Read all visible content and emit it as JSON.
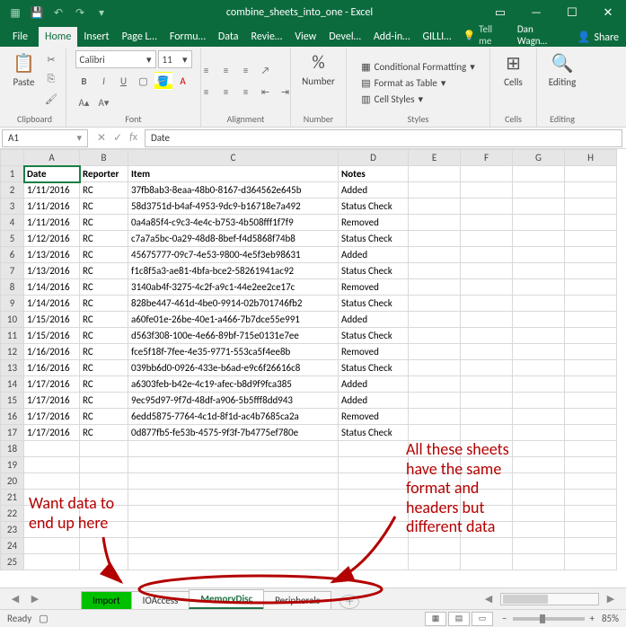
{
  "window": {
    "title": "combine_sheets_into_one - Excel"
  },
  "account": {
    "user": "Dan Wagn…",
    "share": "Share",
    "tellme": "Tell me"
  },
  "tabs": {
    "file": "File",
    "home": "Home",
    "insert": "Insert",
    "pagel": "Page L…",
    "formu": "Formu…",
    "data": "Data",
    "review": "Revie…",
    "view": "View",
    "devel": "Devel…",
    "addin": "Add-in…",
    "gilli": "GILLI…"
  },
  "ribbon": {
    "clipboard": "Clipboard",
    "paste": "Paste",
    "font": "Font",
    "fontname": "Calibri",
    "fontsize": "11",
    "alignment": "Alignment",
    "number": "Number",
    "numberbtn": "Number",
    "styles": "Styles",
    "cond": "Conditional Formatting",
    "table": "Format as Table",
    "cellstyles": "Cell Styles",
    "cells": "Cells",
    "cellsbtn": "Cells",
    "editing": "Editing",
    "editingbtn": "Editing"
  },
  "fx": {
    "namebox": "A1",
    "formula": "Date"
  },
  "columns": [
    "A",
    "B",
    "C",
    "D",
    "E",
    "F",
    "G",
    "H"
  ],
  "headers": {
    "A": "Date",
    "B": "Reporter",
    "C": "Item",
    "D": "Notes"
  },
  "rows": [
    {
      "n": 2,
      "A": "1/11/2016",
      "B": "RC",
      "C": "37fb8ab3-8eaa-48b0-8167-d364562e645b",
      "D": "Added"
    },
    {
      "n": 3,
      "A": "1/11/2016",
      "B": "RC",
      "C": "58d3751d-b4af-4953-9dc9-b16718e7a492",
      "D": "Status Check"
    },
    {
      "n": 4,
      "A": "1/11/2016",
      "B": "RC",
      "C": "0a4a85f4-c9c3-4e4c-b753-4b508fff1f7f9",
      "D": "Removed"
    },
    {
      "n": 5,
      "A": "1/12/2016",
      "B": "RC",
      "C": "c7a7a5bc-0a29-48d8-8bef-f4d5868f74b8",
      "D": "Status Check"
    },
    {
      "n": 6,
      "A": "1/13/2016",
      "B": "RC",
      "C": "45675777-09c7-4e53-9800-4e5f3eb98631",
      "D": "Added"
    },
    {
      "n": 7,
      "A": "1/13/2016",
      "B": "RC",
      "C": "f1c8f5a3-ae81-4bfa-bce2-58261941ac92",
      "D": "Status Check"
    },
    {
      "n": 8,
      "A": "1/14/2016",
      "B": "RC",
      "C": "3140ab4f-3275-4c2f-a9c1-44e2ee2ce17c",
      "D": "Removed"
    },
    {
      "n": 9,
      "A": "1/14/2016",
      "B": "RC",
      "C": "828be447-461d-4be0-9914-02b701746fb2",
      "D": "Status Check"
    },
    {
      "n": 10,
      "A": "1/15/2016",
      "B": "RC",
      "C": "a60fe01e-26be-40e1-a466-7b7dce55e991",
      "D": "Added"
    },
    {
      "n": 11,
      "A": "1/15/2016",
      "B": "RC",
      "C": "d563f308-100e-4e66-89bf-715e0131e7ee",
      "D": "Status Check"
    },
    {
      "n": 12,
      "A": "1/16/2016",
      "B": "RC",
      "C": "fce5f18f-7fee-4e35-9771-553ca5f4ee8b",
      "D": "Removed"
    },
    {
      "n": 13,
      "A": "1/16/2016",
      "B": "RC",
      "C": "039bb6d0-0926-433e-b6ad-e9c6f26616c8",
      "D": "Status Check"
    },
    {
      "n": 14,
      "A": "1/17/2016",
      "B": "RC",
      "C": "a6303feb-b42e-4c19-afec-b8d9f9fca385",
      "D": "Added"
    },
    {
      "n": 15,
      "A": "1/17/2016",
      "B": "RC",
      "C": "9ec95d97-9f7d-48df-a906-5b5fff8dd943",
      "D": "Added"
    },
    {
      "n": 16,
      "A": "1/17/2016",
      "B": "RC",
      "C": "6edd5875-7764-4c1d-8f1d-ac4b7685ca2a",
      "D": "Removed"
    },
    {
      "n": 17,
      "A": "1/17/2016",
      "B": "RC",
      "C": "0d877fb5-fe53b-4575-9f3f-7b4775ef780e",
      "D": "Status Check"
    }
  ],
  "emptyRows": [
    18,
    19,
    20,
    21,
    22,
    23,
    24,
    25
  ],
  "sheets": {
    "import": "Import",
    "ioaccess": "IOAccess",
    "memorydisc": "MemoryDisc",
    "peripherals": "Peripherals"
  },
  "status": {
    "ready": "Ready",
    "zoom": "85%"
  },
  "annotations": {
    "left1": "Want data to",
    "left2": "end up here",
    "right1": "All these sheets",
    "right2": "have the same",
    "right3": "format and",
    "right4": "headers but",
    "right5": "different data"
  }
}
